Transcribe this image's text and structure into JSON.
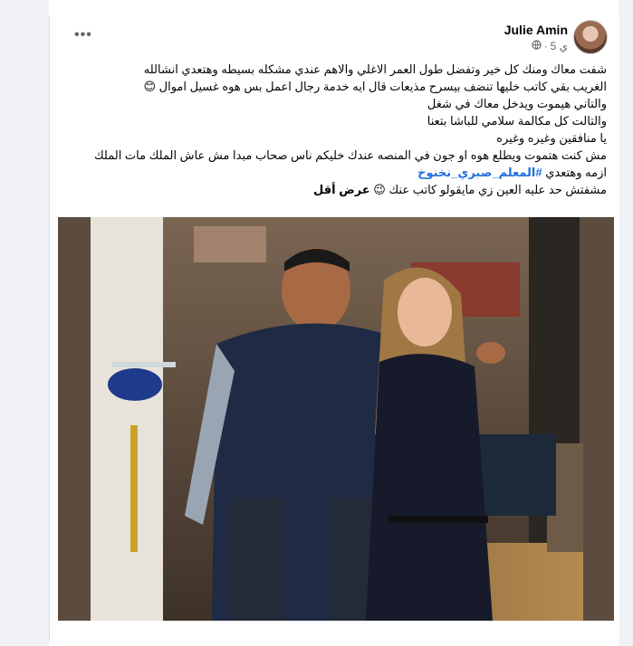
{
  "post": {
    "author": "Julie Amin",
    "time": "5 ي",
    "separator": "·",
    "privacy_icon": "globe-icon",
    "more_label": "•••",
    "text_lines": [
      "شفت معاك ومنك كل خير وتفضل طول العمر الاغلي والاهم عندي مشكله بسيطه وهتعدي انشالله",
      "الغريب بقي كاتب خليها تنضف بيسرح مذيعات قال ايه خدمة  رجال اعمل بس هوه غسيل اموال 😊",
      "والتاني هيموت ويدخل معاك في شغل",
      "والتالت كل مكالمة سلامي للباشا بتعنا",
      "يا منافقين وغيره وغيره",
      "مش كنت هتموت ويطلع هوه او جون في المنصه عندك خليكم ناس صحاب مبدا مش عاش الملك مات الملك"
    ],
    "hashtag_prefix": "ازمه وهتعدي ",
    "hashtag": "#المعلم_صبري_نخنوخ",
    "last_line": "مشفتش حد عليه العين زي مايقولو كاتب عنك 😉 ",
    "see_less": "عرض أقل"
  }
}
